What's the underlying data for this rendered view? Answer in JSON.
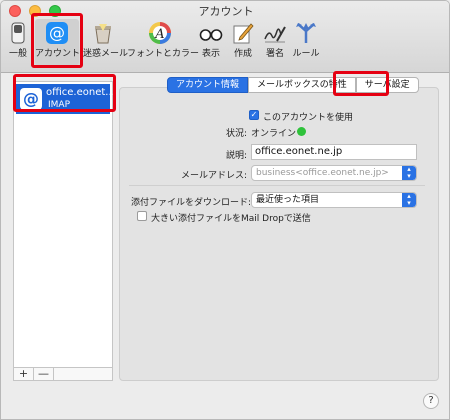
{
  "window": {
    "title": "アカウント"
  },
  "toolbar": {
    "items": [
      {
        "label": "一般",
        "icon": "switch-icon"
      },
      {
        "label": "アカウント",
        "icon": "at-icon"
      },
      {
        "label": "迷惑メール",
        "icon": "junk-mail-icon"
      },
      {
        "label": "フォントとカラー",
        "icon": "font-color-icon"
      },
      {
        "label": "表示",
        "icon": "glasses-icon"
      },
      {
        "label": "作成",
        "icon": "compose-icon"
      },
      {
        "label": "署名",
        "icon": "signature-icon"
      },
      {
        "label": "ルール",
        "icon": "rules-icon"
      }
    ]
  },
  "sidebar": {
    "account": {
      "name": "office.eonet...",
      "type": "IMAP"
    },
    "add_label": "+",
    "remove_label": "—"
  },
  "tabs": [
    {
      "label": "アカウント情報"
    },
    {
      "label": "メールボックスの特性"
    },
    {
      "label": "サーバ設定"
    }
  ],
  "form": {
    "enable_label": "このアカウントを使用",
    "status_label": "状況:",
    "status_value": "オンライン",
    "desc_label": "説明:",
    "desc_value": "office.eonet.ne.jp",
    "email_label": "メールアドレス:",
    "email_value": "business<office.eonet.ne.jp>",
    "attach_label": "添付ファイルをダウンロード:",
    "attach_value": "最近使った項目",
    "maildrop_label": "大きい添付ファイルをMail Dropで送信"
  },
  "help_label": "?",
  "colors": {
    "accent": "#2a72e4",
    "highlight": "#e50012",
    "online": "#2fc23b"
  }
}
